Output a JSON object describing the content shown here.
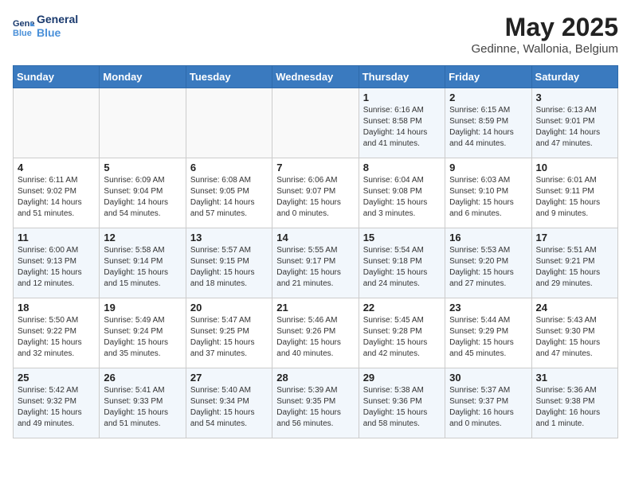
{
  "header": {
    "logo_line1": "General",
    "logo_line2": "Blue",
    "month_year": "May 2025",
    "location": "Gedinne, Wallonia, Belgium"
  },
  "weekdays": [
    "Sunday",
    "Monday",
    "Tuesday",
    "Wednesday",
    "Thursday",
    "Friday",
    "Saturday"
  ],
  "weeks": [
    [
      {
        "num": "",
        "info": ""
      },
      {
        "num": "",
        "info": ""
      },
      {
        "num": "",
        "info": ""
      },
      {
        "num": "",
        "info": ""
      },
      {
        "num": "1",
        "info": "Sunrise: 6:16 AM\nSunset: 8:58 PM\nDaylight: 14 hours\nand 41 minutes."
      },
      {
        "num": "2",
        "info": "Sunrise: 6:15 AM\nSunset: 8:59 PM\nDaylight: 14 hours\nand 44 minutes."
      },
      {
        "num": "3",
        "info": "Sunrise: 6:13 AM\nSunset: 9:01 PM\nDaylight: 14 hours\nand 47 minutes."
      }
    ],
    [
      {
        "num": "4",
        "info": "Sunrise: 6:11 AM\nSunset: 9:02 PM\nDaylight: 14 hours\nand 51 minutes."
      },
      {
        "num": "5",
        "info": "Sunrise: 6:09 AM\nSunset: 9:04 PM\nDaylight: 14 hours\nand 54 minutes."
      },
      {
        "num": "6",
        "info": "Sunrise: 6:08 AM\nSunset: 9:05 PM\nDaylight: 14 hours\nand 57 minutes."
      },
      {
        "num": "7",
        "info": "Sunrise: 6:06 AM\nSunset: 9:07 PM\nDaylight: 15 hours\nand 0 minutes."
      },
      {
        "num": "8",
        "info": "Sunrise: 6:04 AM\nSunset: 9:08 PM\nDaylight: 15 hours\nand 3 minutes."
      },
      {
        "num": "9",
        "info": "Sunrise: 6:03 AM\nSunset: 9:10 PM\nDaylight: 15 hours\nand 6 minutes."
      },
      {
        "num": "10",
        "info": "Sunrise: 6:01 AM\nSunset: 9:11 PM\nDaylight: 15 hours\nand 9 minutes."
      }
    ],
    [
      {
        "num": "11",
        "info": "Sunrise: 6:00 AM\nSunset: 9:13 PM\nDaylight: 15 hours\nand 12 minutes."
      },
      {
        "num": "12",
        "info": "Sunrise: 5:58 AM\nSunset: 9:14 PM\nDaylight: 15 hours\nand 15 minutes."
      },
      {
        "num": "13",
        "info": "Sunrise: 5:57 AM\nSunset: 9:15 PM\nDaylight: 15 hours\nand 18 minutes."
      },
      {
        "num": "14",
        "info": "Sunrise: 5:55 AM\nSunset: 9:17 PM\nDaylight: 15 hours\nand 21 minutes."
      },
      {
        "num": "15",
        "info": "Sunrise: 5:54 AM\nSunset: 9:18 PM\nDaylight: 15 hours\nand 24 minutes."
      },
      {
        "num": "16",
        "info": "Sunrise: 5:53 AM\nSunset: 9:20 PM\nDaylight: 15 hours\nand 27 minutes."
      },
      {
        "num": "17",
        "info": "Sunrise: 5:51 AM\nSunset: 9:21 PM\nDaylight: 15 hours\nand 29 minutes."
      }
    ],
    [
      {
        "num": "18",
        "info": "Sunrise: 5:50 AM\nSunset: 9:22 PM\nDaylight: 15 hours\nand 32 minutes."
      },
      {
        "num": "19",
        "info": "Sunrise: 5:49 AM\nSunset: 9:24 PM\nDaylight: 15 hours\nand 35 minutes."
      },
      {
        "num": "20",
        "info": "Sunrise: 5:47 AM\nSunset: 9:25 PM\nDaylight: 15 hours\nand 37 minutes."
      },
      {
        "num": "21",
        "info": "Sunrise: 5:46 AM\nSunset: 9:26 PM\nDaylight: 15 hours\nand 40 minutes."
      },
      {
        "num": "22",
        "info": "Sunrise: 5:45 AM\nSunset: 9:28 PM\nDaylight: 15 hours\nand 42 minutes."
      },
      {
        "num": "23",
        "info": "Sunrise: 5:44 AM\nSunset: 9:29 PM\nDaylight: 15 hours\nand 45 minutes."
      },
      {
        "num": "24",
        "info": "Sunrise: 5:43 AM\nSunset: 9:30 PM\nDaylight: 15 hours\nand 47 minutes."
      }
    ],
    [
      {
        "num": "25",
        "info": "Sunrise: 5:42 AM\nSunset: 9:32 PM\nDaylight: 15 hours\nand 49 minutes."
      },
      {
        "num": "26",
        "info": "Sunrise: 5:41 AM\nSunset: 9:33 PM\nDaylight: 15 hours\nand 51 minutes."
      },
      {
        "num": "27",
        "info": "Sunrise: 5:40 AM\nSunset: 9:34 PM\nDaylight: 15 hours\nand 54 minutes."
      },
      {
        "num": "28",
        "info": "Sunrise: 5:39 AM\nSunset: 9:35 PM\nDaylight: 15 hours\nand 56 minutes."
      },
      {
        "num": "29",
        "info": "Sunrise: 5:38 AM\nSunset: 9:36 PM\nDaylight: 15 hours\nand 58 minutes."
      },
      {
        "num": "30",
        "info": "Sunrise: 5:37 AM\nSunset: 9:37 PM\nDaylight: 16 hours\nand 0 minutes."
      },
      {
        "num": "31",
        "info": "Sunrise: 5:36 AM\nSunset: 9:38 PM\nDaylight: 16 hours\nand 1 minute."
      }
    ]
  ]
}
